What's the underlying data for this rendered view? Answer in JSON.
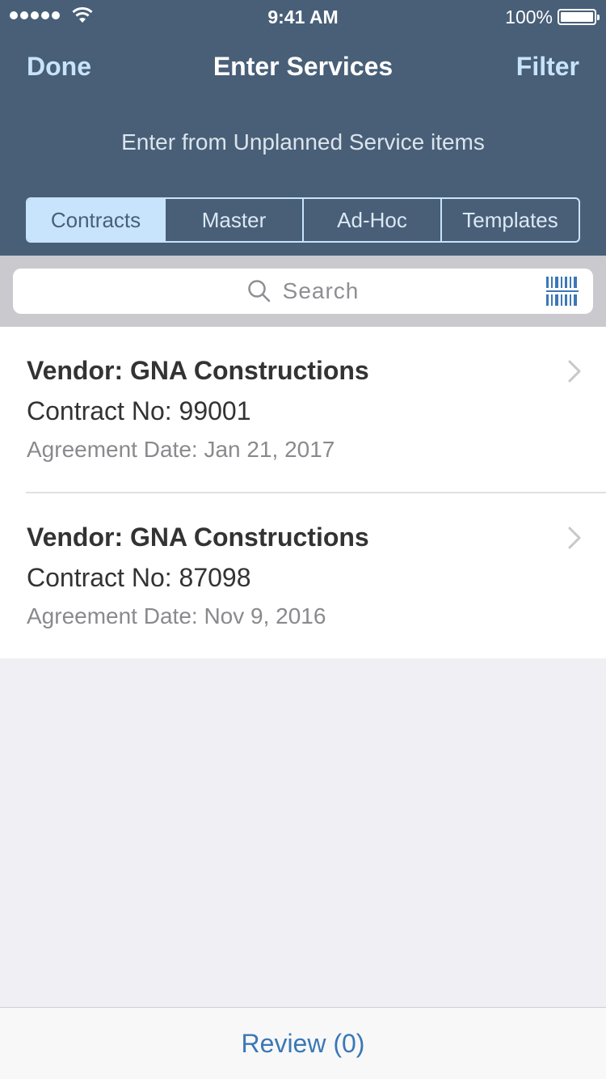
{
  "status_bar": {
    "time": "9:41 AM",
    "battery": "100%"
  },
  "nav": {
    "done_label": "Done",
    "title": "Enter Services",
    "filter_label": "Filter"
  },
  "subtitle": "Enter from Unplanned Service items",
  "segments": [
    {
      "label": "Contracts",
      "active": true
    },
    {
      "label": "Master",
      "active": false
    },
    {
      "label": "Ad-Hoc",
      "active": false
    },
    {
      "label": "Templates",
      "active": false
    }
  ],
  "search": {
    "placeholder": "Search"
  },
  "contracts": [
    {
      "vendor": "Vendor: GNA Constructions",
      "contract": "Contract No: 99001",
      "date": "Agreement Date: Jan 21, 2017"
    },
    {
      "vendor": "Vendor: GNA Constructions",
      "contract": "Contract No: 87098",
      "date": "Agreement Date: Nov 9, 2016"
    }
  ],
  "footer": {
    "review_label": "Review (0)"
  },
  "colors": {
    "header_bg": "#485f77",
    "accent": "#c8e4fc",
    "link": "#3a78b6"
  },
  "icons": [
    "signal-icon",
    "wifi-icon",
    "battery-icon",
    "search-icon",
    "barcode-scan-icon",
    "chevron-right-icon"
  ]
}
